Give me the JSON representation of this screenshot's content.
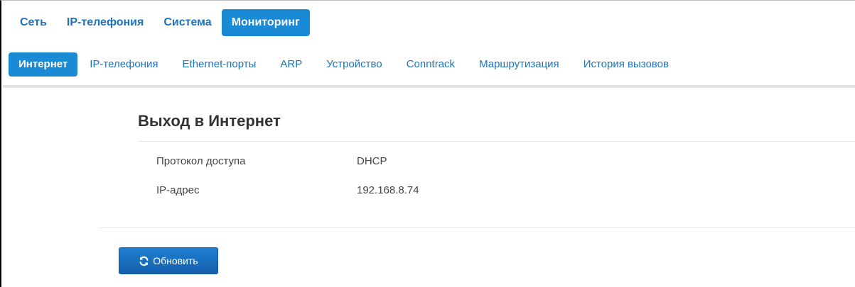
{
  "top_tabs": [
    {
      "label": "Сеть",
      "active": false
    },
    {
      "label": "IP-телефония",
      "active": false
    },
    {
      "label": "Система",
      "active": false
    },
    {
      "label": "Мониторинг",
      "active": true
    }
  ],
  "sub_tabs": [
    {
      "label": "Интернет",
      "active": true
    },
    {
      "label": "IP-телефония",
      "active": false
    },
    {
      "label": "Ethernet-порты",
      "active": false
    },
    {
      "label": "ARP",
      "active": false
    },
    {
      "label": "Устройство",
      "active": false
    },
    {
      "label": "Conntrack",
      "active": false
    },
    {
      "label": "Маршрутизация",
      "active": false
    },
    {
      "label": "История вызовов",
      "active": false
    }
  ],
  "section": {
    "title": "Выход в Интернет",
    "rows": [
      {
        "label": "Протокол доступа",
        "value": "DHCP"
      },
      {
        "label": "IP-адрес",
        "value": "192.168.8.74"
      }
    ]
  },
  "refresh_button": {
    "label": "Обновить",
    "icon": "refresh-icon"
  },
  "colors": {
    "accent": "#1a8ad4",
    "link": "#1e73be",
    "button": "#1565b8"
  }
}
